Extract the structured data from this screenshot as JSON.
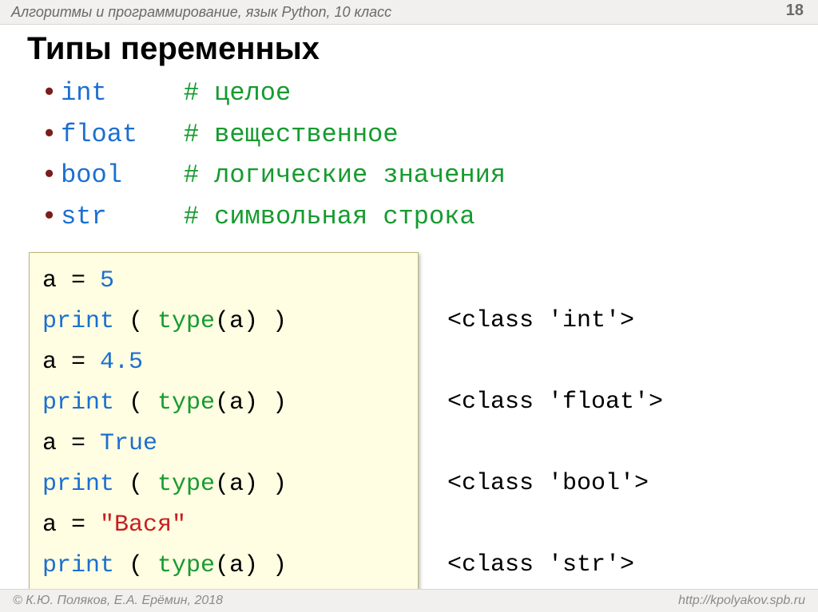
{
  "header": {
    "breadcrumb": "Алгоритмы и программирование, язык Python, 10 класс",
    "page": "18"
  },
  "title": "Типы переменных",
  "types": [
    {
      "name": "int",
      "pad": "     ",
      "comment": "# целое"
    },
    {
      "name": "float",
      "pad": "   ",
      "comment": "# вещественное"
    },
    {
      "name": "bool",
      "pad": "    ",
      "comment": "# логические значения"
    },
    {
      "name": "str",
      "pad": "     ",
      "comment": "# символьная строка"
    }
  ],
  "code": {
    "a": "a",
    "eq": " = ",
    "print": "print",
    "type": "type",
    "lpar_sp": " ( ",
    "lpar": "(",
    "rpar": ")",
    "rpar_sp": " )",
    "v_int": "5",
    "v_float": "4.5",
    "v_bool": "True",
    "v_str": "\"Вася\""
  },
  "outputs": {
    "int": "<class 'int'>",
    "float": "<class 'float'>",
    "bool": "<class 'bool'>",
    "str": "<class 'str'>"
  },
  "footer": {
    "left": "© К.Ю. Поляков, Е.А. Ерёмин, 2018",
    "right": "http://kpolyakov.spb.ru"
  }
}
